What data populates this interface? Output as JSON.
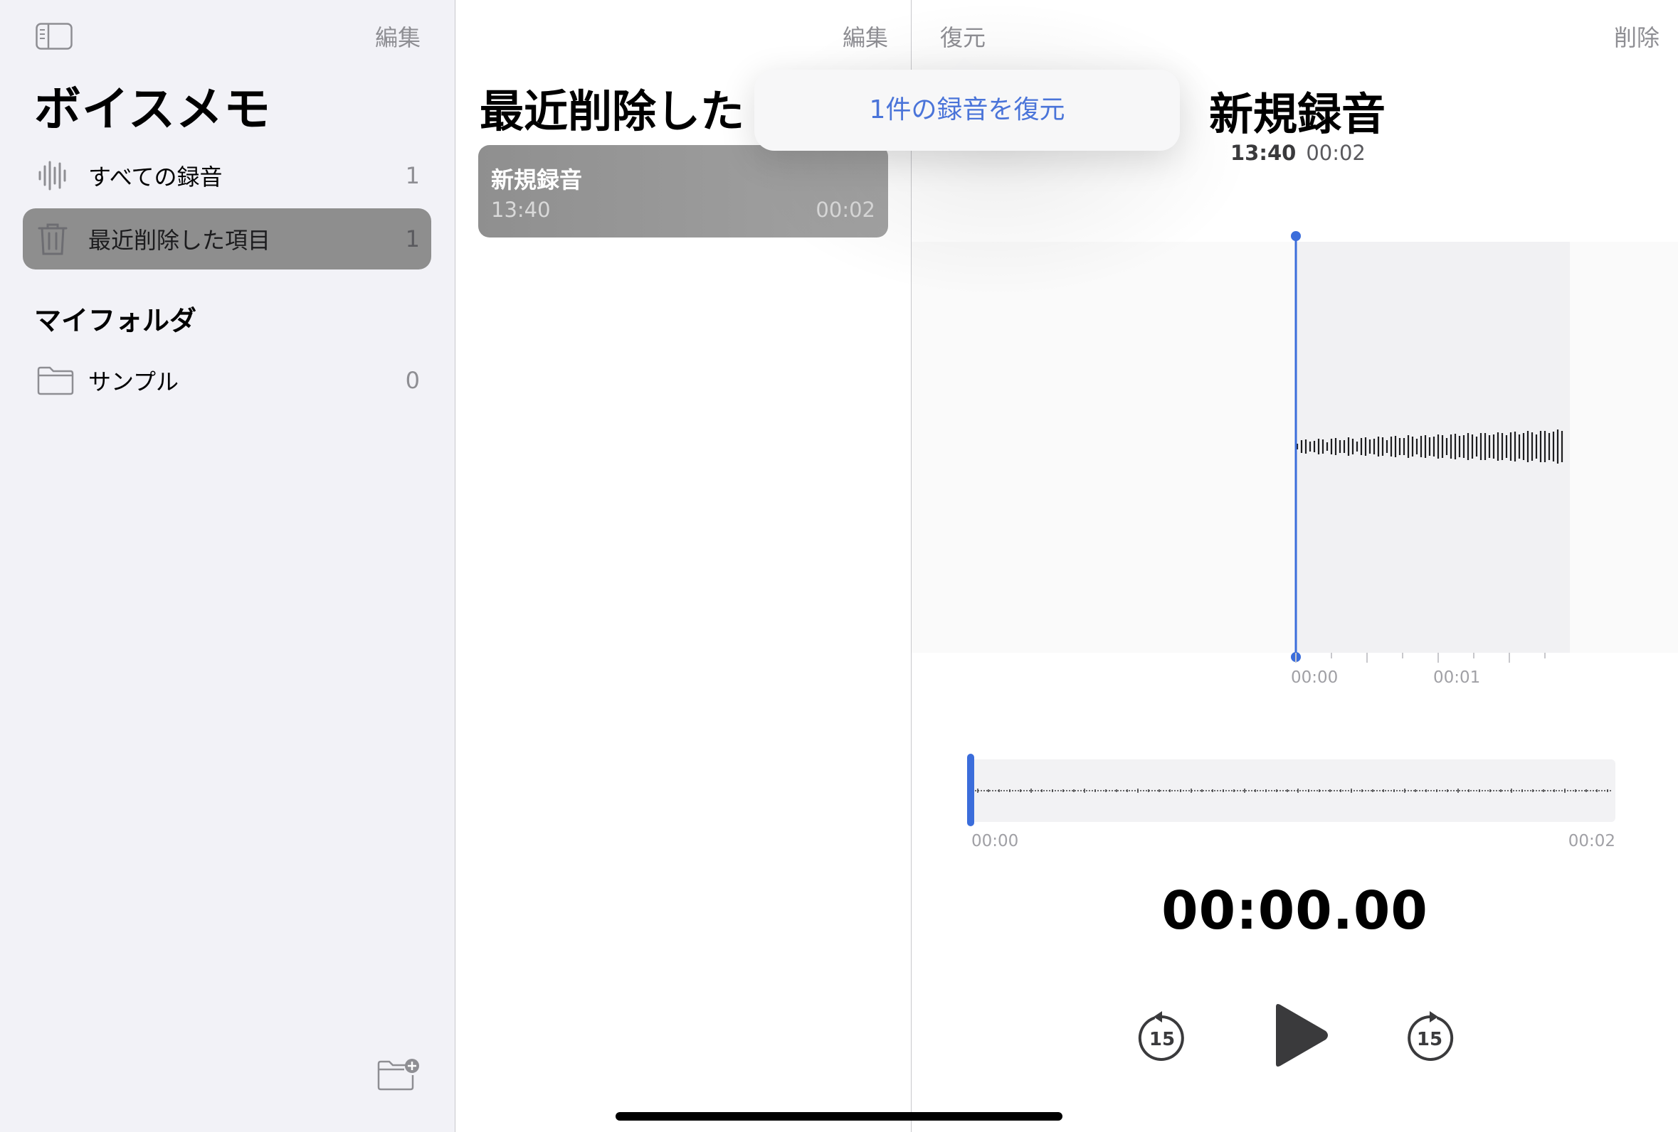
{
  "sidebar": {
    "edit_label": "編集",
    "title": "ボイスメモ",
    "items": [
      {
        "label": "すべての録音",
        "count": "1",
        "icon": "waveform-icon"
      },
      {
        "label": "最近削除した項目",
        "count": "1",
        "icon": "trash-icon"
      }
    ],
    "folders_heading": "マイフォルダ",
    "folders": [
      {
        "label": "サンプル",
        "count": "0",
        "icon": "folder-icon"
      }
    ]
  },
  "list": {
    "edit_label": "編集",
    "title": "最近削除した",
    "recordings": [
      {
        "title": "新規録音",
        "date": "13:40",
        "length": "00:02"
      }
    ]
  },
  "detail": {
    "restore_label": "復元",
    "delete_label": "削除",
    "title": "新規録音",
    "time": "13:40",
    "length": "00:02",
    "ruler_labels": [
      "00:00",
      "00:01"
    ],
    "scrub_start": "00:00",
    "scrub_end": "00:02",
    "clock": "00:00.00",
    "skip_back_label": "15",
    "skip_fwd_label": "15"
  },
  "popover": {
    "option_label": "1件の録音を復元"
  },
  "colors": {
    "accent": "#3b6ddb",
    "selected_row": "#8e8e8e",
    "sidebar_bg": "#f2f2f7"
  }
}
